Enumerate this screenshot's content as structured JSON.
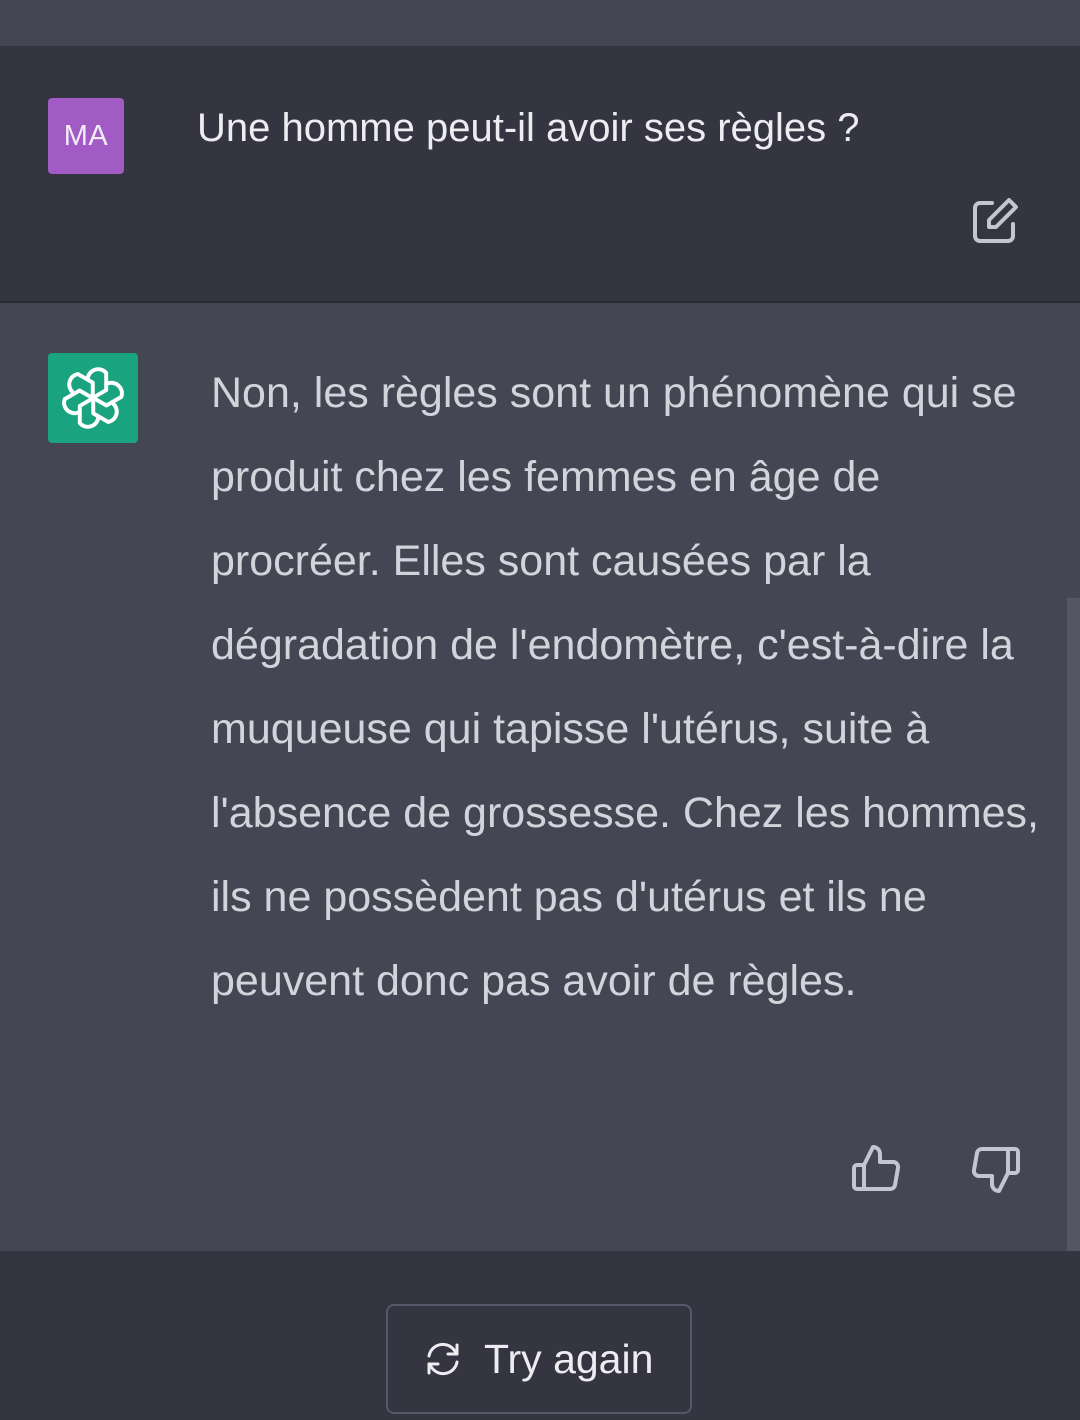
{
  "conversation": {
    "user_message": {
      "avatar_initials": "MA",
      "avatar_color": "#a25bc4",
      "text": "Une homme peut-il avoir ses règles ?",
      "edit_icon": "edit-icon"
    },
    "assistant_message": {
      "avatar_icon": "openai-logo-icon",
      "avatar_color": "#19a37f",
      "text": "Non, les règles sont un phénomène qui se produit chez les femmes en âge de procréer. Elles sont causées par la dégradation de l'endomètre, c'est-à-dire la muqueuse qui tapisse l'utérus, suite à l'absence de grossesse. Chez les hommes, ils ne possèdent pas d'utérus et ils ne peuvent donc pas avoir de règles.",
      "feedback": {
        "thumbs_up_icon": "thumbs-up-icon",
        "thumbs_down_icon": "thumbs-down-icon"
      }
    }
  },
  "actions": {
    "try_again_label": "Try again",
    "try_again_icon": "refresh-icon"
  },
  "colors": {
    "user_bg": "#343541",
    "assistant_bg": "#444654",
    "text_primary": "#ececf1",
    "text_assistant": "#d1d5db"
  }
}
